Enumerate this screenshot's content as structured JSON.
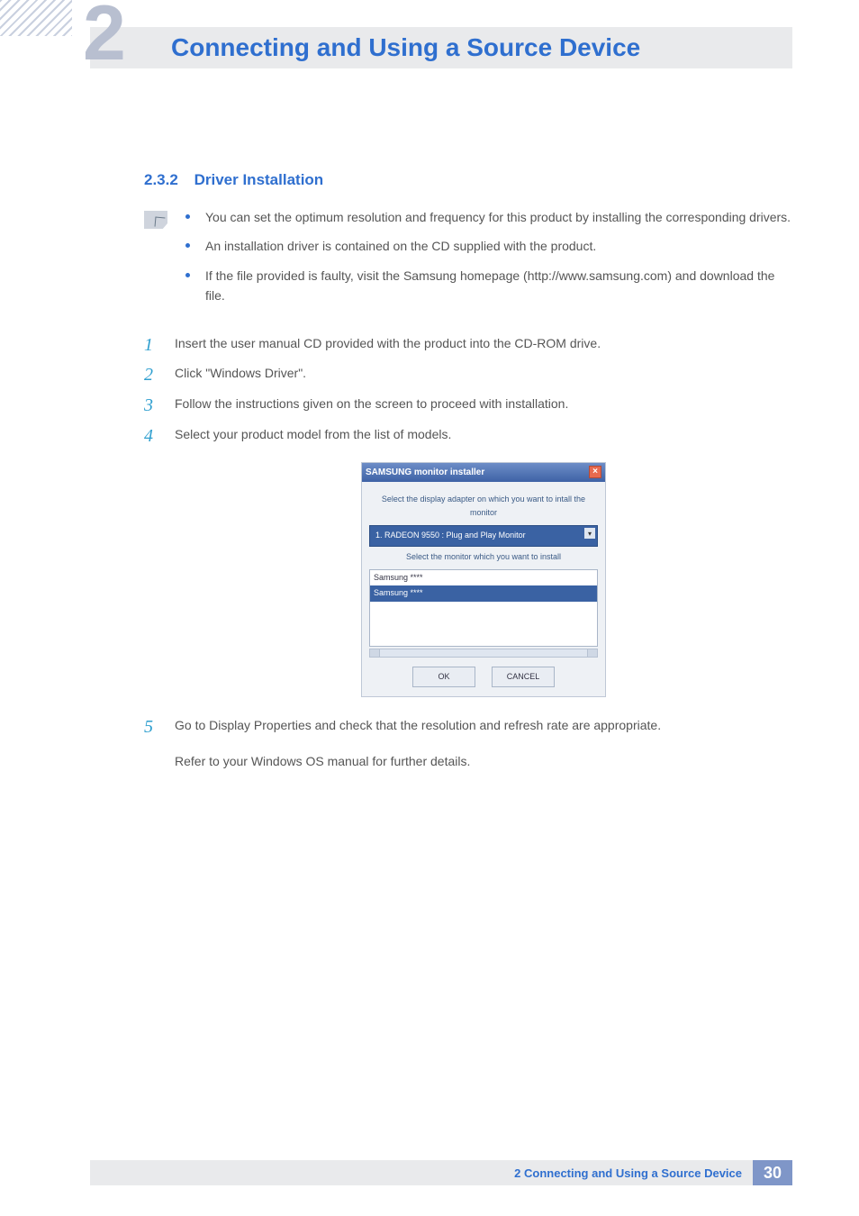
{
  "header": {
    "chapter_number": "2",
    "title": "Connecting and Using a Source Device"
  },
  "section": {
    "number": "2.3.2",
    "title": "Driver Installation"
  },
  "notes": [
    "You can set the optimum resolution and frequency for this product by installing the corresponding drivers.",
    "An installation driver is contained on the CD supplied with the product.",
    "If the file provided is faulty, visit the Samsung homepage (http://www.samsung.com) and download the file."
  ],
  "steps": [
    {
      "n": "1",
      "text": "Insert the user manual CD provided with the product into the CD-ROM drive."
    },
    {
      "n": "2",
      "text": "Click \"Windows Driver\"."
    },
    {
      "n": "3",
      "text": "Follow the instructions given on the screen to proceed with installation."
    },
    {
      "n": "4",
      "text": "Select your product model from the list of models."
    },
    {
      "n": "5",
      "text": "Go to Display Properties and check that the resolution and refresh rate are appropriate.",
      "after": "Refer to your Windows OS manual for further details."
    }
  ],
  "installer": {
    "title": "SAMSUNG monitor installer",
    "label1": "Select the display adapter on which you want to intall the monitor",
    "combo": "1. RADEON 9550 : Plug and Play Monitor",
    "label2": "Select the monitor which you want to install",
    "list": [
      "Samsung ****",
      "Samsung ****"
    ],
    "ok": "OK",
    "cancel": "CANCEL"
  },
  "footer": {
    "text": "2 Connecting and Using a Source Device",
    "page": "30"
  }
}
